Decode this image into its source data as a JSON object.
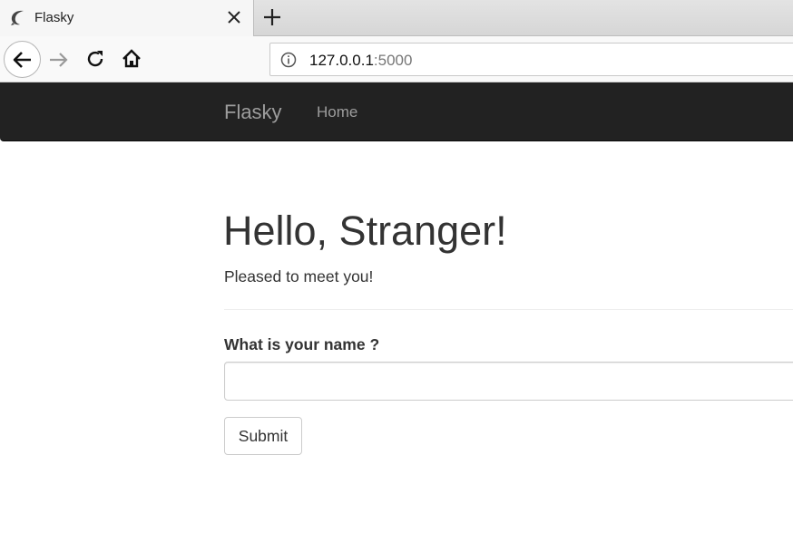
{
  "browser": {
    "tab": {
      "title": "Flasky"
    },
    "address": {
      "host": "127.0.0.1",
      "port": ":5000"
    }
  },
  "navbar": {
    "brand": "Flasky",
    "links": [
      {
        "label": "Home"
      }
    ]
  },
  "main": {
    "heading": "Hello, Stranger!",
    "lead": "Pleased to meet you!",
    "form": {
      "name_label": "What is your name ?",
      "name_value": "",
      "name_placeholder": "",
      "submit_label": "Submit"
    }
  },
  "colors": {
    "navbar_bg": "#222222",
    "navbar_text": "#9d9d9d",
    "text": "#333333"
  },
  "icons": [
    "favicon-icon",
    "close-icon",
    "plus-icon",
    "back-arrow-icon",
    "forward-arrow-icon",
    "reload-icon",
    "home-icon",
    "info-icon"
  ]
}
